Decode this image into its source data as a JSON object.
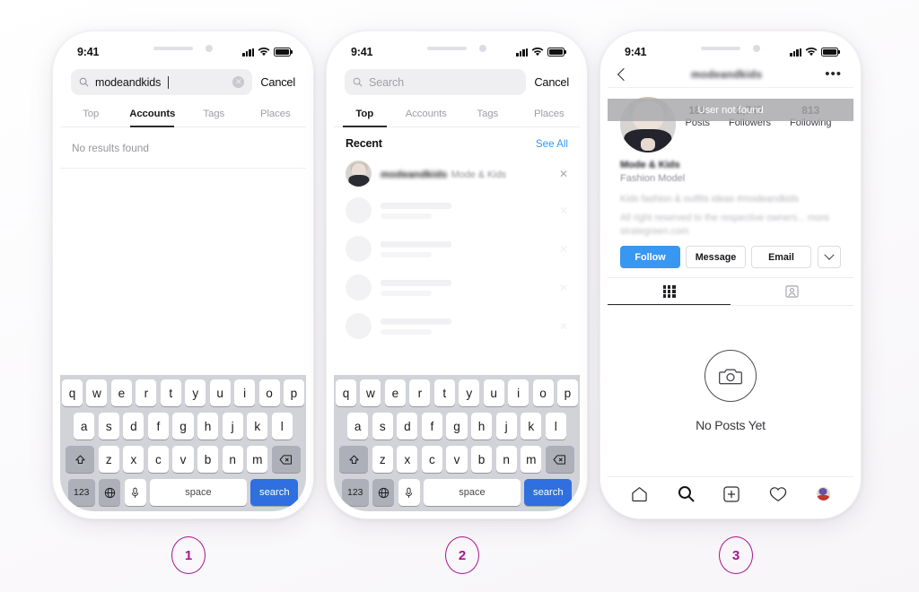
{
  "meta": {
    "accent_blue": "#3897f0",
    "badge_purple": "#a6158c",
    "keyboard_bg": "#d1d3d9",
    "banner_grey": "#aaaaae"
  },
  "status_bar": {
    "time": "9:41",
    "signal_icon": "cellular-bars-icon",
    "wifi_icon": "wifi-icon",
    "battery_icon": "battery-icon"
  },
  "phone1": {
    "search": {
      "value": "modeandkids",
      "placeholder": "Search",
      "search_icon": "search-icon",
      "clear_icon": "clear-icon",
      "cancel_label": "Cancel"
    },
    "tabs": [
      {
        "label": "Top",
        "active": false
      },
      {
        "label": "Accounts",
        "active": true
      },
      {
        "label": "Tags",
        "active": false
      },
      {
        "label": "Places",
        "active": false
      }
    ],
    "empty_state": "No results found"
  },
  "phone2": {
    "search": {
      "value": "",
      "placeholder": "Search",
      "search_icon": "search-icon",
      "cancel_label": "Cancel"
    },
    "tabs": [
      {
        "label": "Top",
        "active": true
      },
      {
        "label": "Accounts",
        "active": false
      },
      {
        "label": "Tags",
        "active": false
      },
      {
        "label": "Places",
        "active": false
      }
    ],
    "recent": {
      "title": "Recent",
      "see_all_label": "See All",
      "items": [
        {
          "username": "modeandkids",
          "fullname": "Mode & Kids",
          "remove_icon": "close-icon"
        }
      ],
      "placeholder_rows": 4
    }
  },
  "phone3": {
    "header": {
      "back_icon": "chevron-left-icon",
      "title": "modeandkids",
      "menu_icon": "more-options-icon"
    },
    "banner": {
      "text": "User not found"
    },
    "stats": [
      {
        "value": "188",
        "label": "Posts"
      },
      {
        "value": "2,747",
        "label": "Followers"
      },
      {
        "value": "813",
        "label": "Following"
      }
    ],
    "bio": {
      "name": "Mode & Kids",
      "category": "Fashion Model",
      "line1": "Kids fashion & outfits ideas #modeandkids",
      "line2": "All right reserved to the respective owners... more",
      "line3": "strategreen.com"
    },
    "actions": [
      {
        "label": "Follow",
        "primary": true
      },
      {
        "label": "Message",
        "primary": false
      },
      {
        "label": "Email",
        "primary": false
      }
    ],
    "actions_more_icon": "chevron-down-icon",
    "content_tabs": [
      {
        "icon": "grid-icon",
        "active": true
      },
      {
        "icon": "tagged-photos-icon",
        "active": false
      }
    ],
    "empty": {
      "icon": "camera-icon",
      "text": "No Posts Yet"
    },
    "tabbar": [
      {
        "icon": "home-icon",
        "active": false
      },
      {
        "icon": "search-icon",
        "active": true
      },
      {
        "icon": "add-post-icon",
        "active": false
      },
      {
        "icon": "heart-icon",
        "active": false
      },
      {
        "icon": "profile-avatar-icon",
        "active": false
      }
    ]
  },
  "keyboard": {
    "row1": [
      "q",
      "w",
      "e",
      "r",
      "t",
      "y",
      "u",
      "i",
      "o",
      "p"
    ],
    "row2": [
      "a",
      "s",
      "d",
      "f",
      "g",
      "h",
      "j",
      "k",
      "l"
    ],
    "row3": [
      "z",
      "x",
      "c",
      "v",
      "b",
      "n",
      "m"
    ],
    "shift_icon": "shift-icon",
    "backspace_icon": "backspace-icon",
    "numbers_label": "123",
    "globe_icon": "globe-icon",
    "mic_icon": "microphone-icon",
    "space_label": "space",
    "search_label": "search"
  },
  "badges": [
    {
      "number": "1"
    },
    {
      "number": "2"
    },
    {
      "number": "3"
    }
  ]
}
